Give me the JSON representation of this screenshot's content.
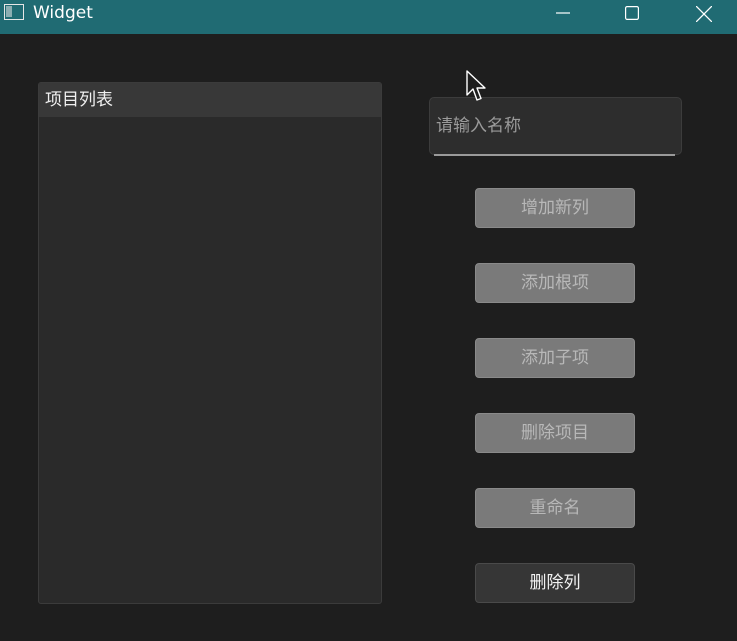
{
  "window": {
    "title": "Widget",
    "colors": {
      "titlebar": "#206b73",
      "background": "#1e1e1e"
    },
    "controls": [
      "minimize-icon",
      "maximize-icon",
      "close-icon"
    ]
  },
  "tree": {
    "header": "项目列表",
    "items": []
  },
  "name_input": {
    "value": "",
    "placeholder": "请输入名称"
  },
  "buttons": {
    "add_column": "增加新列",
    "add_root": "添加根项",
    "add_child": "添加子项",
    "delete_item": "删除项目",
    "rename": "重命名",
    "delete_column": "删除列"
  }
}
